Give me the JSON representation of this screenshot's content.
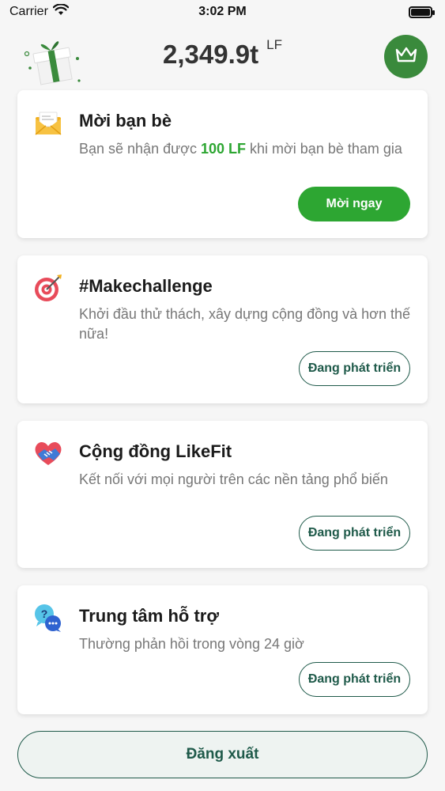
{
  "status_bar": {
    "carrier": "Carrier",
    "time": "3:02 PM"
  },
  "header": {
    "balance": "2,349.9t",
    "balance_unit": "LF"
  },
  "cards": [
    {
      "title": "Mời bạn bè",
      "desc_prefix": "Bạn sẽ nhận được ",
      "desc_highlight": "100 LF",
      "desc_suffix": " khi mời bạn bè tham gia",
      "button": "Mời ngay",
      "icon": "envelope-icon"
    },
    {
      "title": "#Makechallenge",
      "desc": "Khởi đầu thử thách, xây dựng cộng đồng và hơn thế nữa!",
      "button": "Đang phát triển",
      "icon": "target-icon"
    },
    {
      "title": "Cộng đồng LikeFit",
      "desc": "Kết nối với mọi người trên các nền tảng phổ biến",
      "button": "Đang phát triển",
      "icon": "handshake-heart-icon"
    },
    {
      "title": "Trung tâm hỗ trợ",
      "desc": "Thường phản hồi trong vòng 24 giờ",
      "button": "Đang phát triển",
      "icon": "help-chat-icon"
    }
  ],
  "logout_label": "Đăng xuất",
  "colors": {
    "accent_green": "#2da632",
    "dark_green": "#1f5a4a",
    "crown_bg": "#3a8a3c"
  }
}
